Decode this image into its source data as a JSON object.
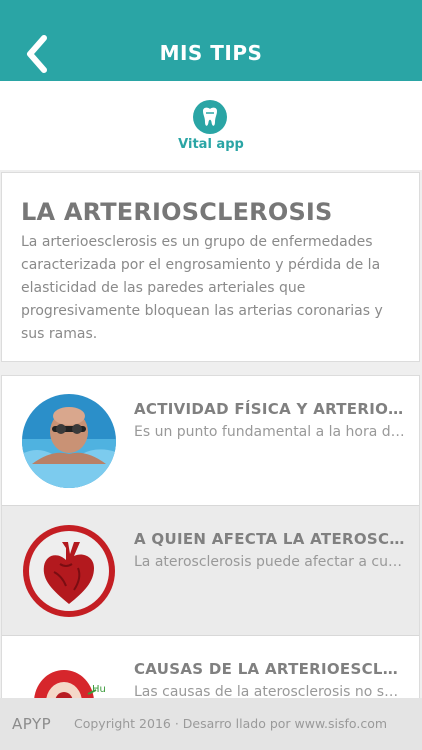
{
  "header": {
    "title": "MIS TIPS",
    "back_icon": "chevron-left-icon",
    "background_color": "#2aa5a5"
  },
  "logo": {
    "text": "Vital app",
    "icon": "tooth-icon"
  },
  "intro": {
    "title": "LA ARTERIOSCLEROSIS",
    "body": "La arterioesclerosis es un grupo de enfermedades caracterizada por el engrosamiento y pérdida de la elasticidad de las paredes arteriales que progresivamente bloquean las arterias coronarias y sus ramas."
  },
  "items": [
    {
      "title": "ACTIVIDAD FÍSICA Y ARTERIOESCLEROSIS",
      "subtitle": "Es un punto fundamental a la hora de prevenir",
      "thumb": "swimmer-photo"
    },
    {
      "title": "A QUIEN AFECTA LA ATEROSCLEROSIS",
      "subtitle": "La aterosclerosis puede afectar a cualquier persona",
      "thumb": "heart-icon"
    },
    {
      "title": "CAUSAS DE LA ARTERIOESCLEROSIS",
      "subtitle": "Las causas de la aterosclerosis no son del todo",
      "thumb": "artery-image"
    }
  ],
  "footer": {
    "brand": "APYP",
    "copyright": "Copyright 2016 · Desarro llado por www.sisfo.com"
  }
}
